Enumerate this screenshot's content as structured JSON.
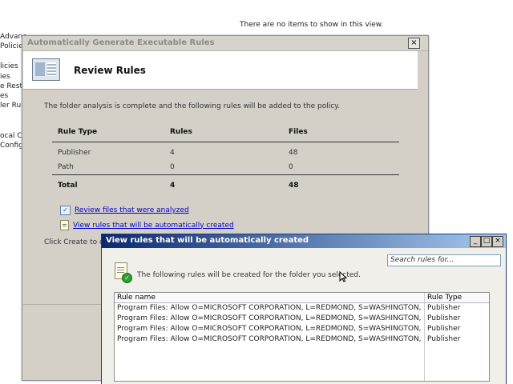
{
  "background": {
    "tree_items": [
      "Advanc",
      "Policies",
      "licies",
      "ies",
      "e Rest",
      "es",
      "ler Rul",
      "ocal C",
      "Configu"
    ],
    "empty_message": "There are no items to show in this view."
  },
  "wizard": {
    "title": "Automatically Generate Executable Rules",
    "close_glyph": "×",
    "header_title": "Review Rules",
    "intro_text": "The folder analysis is complete and the following rules will be added to the policy.",
    "table": {
      "headers": [
        "Rule Type",
        "Rules",
        "Files"
      ],
      "rows": [
        {
          "type": "Publisher",
          "rules": "4",
          "files": "48"
        },
        {
          "type": "Path",
          "rules": "0",
          "files": "0"
        }
      ],
      "total": {
        "label": "Total",
        "rules": "4",
        "files": "48"
      }
    },
    "link_review_files": "Review files that were analyzed",
    "link_view_rules": "View rules that will be automatically created",
    "create_message": "Click Create to clos"
  },
  "rules_window": {
    "title": "View rules that will be automatically created",
    "buttons": {
      "minimize": "_",
      "maximize": "□",
      "close": "×"
    },
    "search_placeholder": "Search rules for...",
    "message": "The following rules will be created for the folder you selected.",
    "columns": [
      "Rule name",
      "Rule Type"
    ],
    "rows": [
      {
        "name": "Program Files: Allow O=MICROSOFT CORPORATION, L=REDMOND, S=WASHINGTON, C=US\\MIC...",
        "type": "Publisher"
      },
      {
        "name": "Program Files: Allow O=MICROSOFT CORPORATION, L=REDMOND, S=WASHINGTON, C=US",
        "type": "Publisher"
      },
      {
        "name": "Program Files: Allow O=MICROSOFT CORPORATION, L=REDMOND, S=WASHINGTON, C=US\\WI...",
        "type": "Publisher"
      },
      {
        "name": "Program Files: Allow O=MICROSOFT CORPORATION, L=REDMOND, S=WASHINGTON, C=US\\MA...",
        "type": "Publisher"
      }
    ]
  }
}
